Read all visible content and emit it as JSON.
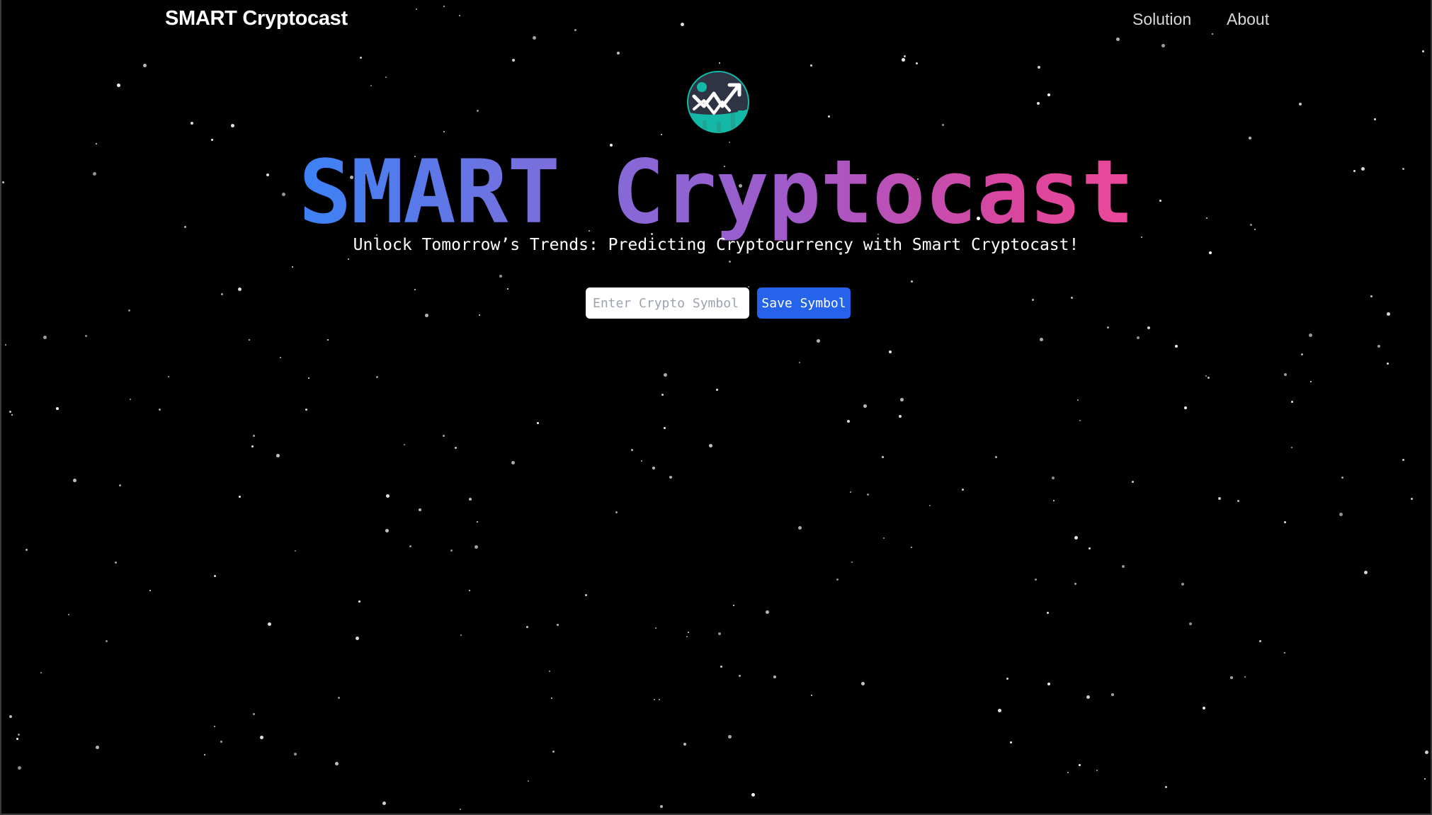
{
  "navbar": {
    "brand": "SMART Cryptocast",
    "links": [
      {
        "label": "Solution"
      },
      {
        "label": "About"
      }
    ]
  },
  "hero": {
    "logo_icon": "trend-chart-logo-icon",
    "title": "SMART Cryptocast",
    "subtitle": "Unlock Tomorrow’s Trends: Predicting Cryptocurrency with Smart Cryptocast!"
  },
  "symbol_form": {
    "input_value": "",
    "input_placeholder": "Enter Crypto Symbol (e.g., BTC)",
    "save_label": "Save Symbol"
  },
  "colors": {
    "background": "#000000",
    "gradient_start": "#3b82f6",
    "gradient_end": "#ec4899",
    "button": "#2563eb",
    "logo_teal": "#14b8a6",
    "logo_dark": "#2f3445"
  }
}
